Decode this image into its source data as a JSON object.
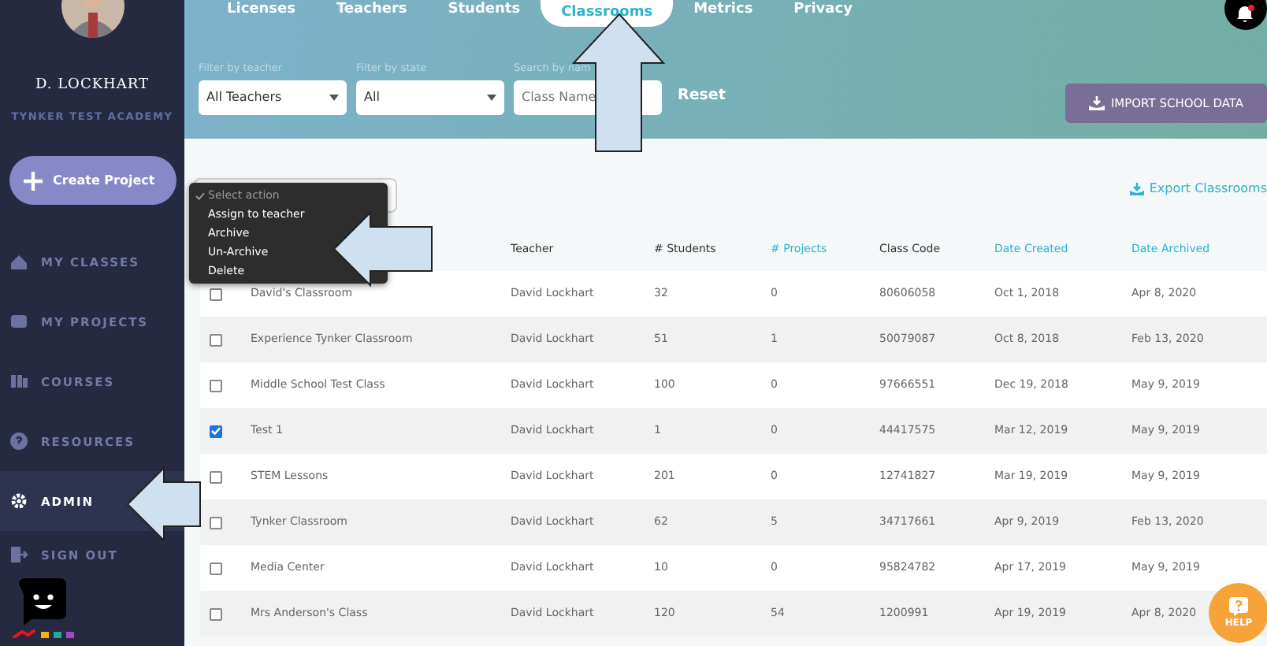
{
  "sidebar": {
    "user_name": "D. LOCKHART",
    "school": "TYNKER TEST ACADEMY",
    "create_button": "Create Project",
    "nav": [
      {
        "label": "MY CLASSES",
        "selected": false
      },
      {
        "label": "MY PROJECTS",
        "selected": false
      },
      {
        "label": "COURSES",
        "selected": false
      },
      {
        "label": "RESOURCES",
        "selected": false
      },
      {
        "label": "ADMIN",
        "selected": true
      },
      {
        "label": "SIGN OUT",
        "selected": false
      }
    ]
  },
  "tabs": [
    {
      "label": "Licenses",
      "selected": false
    },
    {
      "label": "Teachers",
      "selected": false
    },
    {
      "label": "Students",
      "selected": false
    },
    {
      "label": "Classrooms",
      "selected": true
    },
    {
      "label": "Metrics",
      "selected": false
    },
    {
      "label": "Privacy",
      "selected": false
    }
  ],
  "filters": [
    {
      "label": "Filter by teacher",
      "kind": "select",
      "value": "All Teachers"
    },
    {
      "label": "Filter by state",
      "kind": "select",
      "value": "All"
    },
    {
      "label": "Search by nam",
      "kind": "text",
      "placeholder": "Class Name"
    }
  ],
  "reset_button": "Reset",
  "import_button": "IMPORT SCHOOL DATA",
  "export_link": "Export Classrooms",
  "action_menu": [
    {
      "label": "Select action",
      "selected": true
    },
    {
      "label": "Assign to teacher",
      "selected": false
    },
    {
      "label": "Archive",
      "selected": false
    },
    {
      "label": "Un-Archive",
      "selected": false
    },
    {
      "label": "Delete",
      "selected": false
    }
  ],
  "table": {
    "columns": [
      {
        "label": "Teacher",
        "link": false
      },
      {
        "label": "# Students",
        "link": false
      },
      {
        "label": "# Projects",
        "link": true
      },
      {
        "label": "Class Code",
        "link": false
      },
      {
        "label": "Date Created",
        "link": true
      },
      {
        "label": "Date Archived",
        "link": true
      }
    ],
    "rows": [
      {
        "checked": false,
        "class_name": "David's Classroom",
        "cells": [
          "David Lockhart",
          "32",
          "0",
          "80606058",
          "Oct 1, 2018",
          "Apr 8, 2020"
        ]
      },
      {
        "checked": false,
        "class_name": "Experience Tynker Classroom",
        "cells": [
          "David Lockhart",
          "51",
          "1",
          "50079087",
          "Oct 8, 2018",
          "Feb 13, 2020"
        ]
      },
      {
        "checked": false,
        "class_name": "Middle School Test Class",
        "cells": [
          "David Lockhart",
          "100",
          "0",
          "97666551",
          "Dec 19, 2018",
          "May 9, 2019"
        ]
      },
      {
        "checked": true,
        "class_name": "Test 1",
        "cells": [
          "David Lockhart",
          "1",
          "0",
          "44417575",
          "Mar 12, 2019",
          "May 9, 2019"
        ]
      },
      {
        "checked": false,
        "class_name": "STEM Lessons",
        "cells": [
          "David Lockhart",
          "201",
          "0",
          "12741827",
          "Mar 19, 2019",
          "May 9, 2019"
        ]
      },
      {
        "checked": false,
        "class_name": "Tynker Classroom",
        "cells": [
          "David Lockhart",
          "62",
          "5",
          "34717661",
          "Apr 9, 2019",
          "Feb 13, 2020"
        ]
      },
      {
        "checked": false,
        "class_name": "Media Center",
        "cells": [
          "David Lockhart",
          "10",
          "0",
          "95824782",
          "Apr 17, 2019",
          "May 9, 2019"
        ]
      },
      {
        "checked": false,
        "class_name": "Mrs Anderson's Class",
        "cells": [
          "David Lockhart",
          "120",
          "54",
          "1200991",
          "Apr 19, 2019",
          "Apr 8, 2020"
        ]
      }
    ]
  },
  "help_button": "HELP",
  "callout_arrows": [
    {
      "kind": "up"
    },
    {
      "kind": "left"
    },
    {
      "kind": "left"
    }
  ]
}
